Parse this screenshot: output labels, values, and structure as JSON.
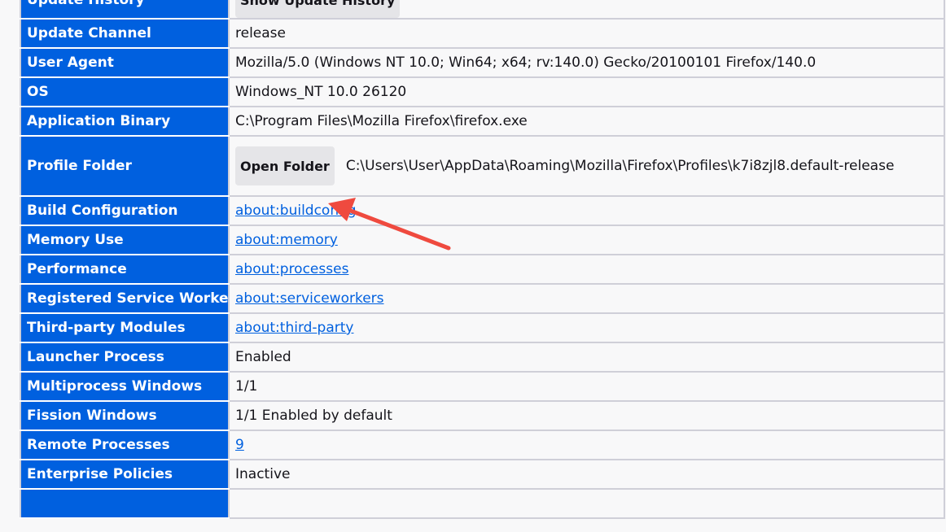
{
  "app_info": {
    "rows": [
      {
        "label": "Update History",
        "button": "Show Update History"
      },
      {
        "label": "Update Channel",
        "value": "release"
      },
      {
        "label": "User Agent",
        "value": "Mozilla/5.0 (Windows NT 10.0; Win64; x64; rv:140.0) Gecko/20100101 Firefox/140.0"
      },
      {
        "label": "OS",
        "value": "Windows_NT 10.0 26120"
      },
      {
        "label": "Application Binary",
        "value": "C:\\Program Files\\Mozilla Firefox\\firefox.exe"
      },
      {
        "label": "Profile Folder",
        "button": "Open Folder",
        "value": "C:\\Users\\User\\AppData\\Roaming\\Mozilla\\Firefox\\Profiles\\k7i8zjl8.default-release"
      },
      {
        "label": "Build Configuration",
        "link": "about:buildconfig"
      },
      {
        "label": "Memory Use",
        "link": "about:memory"
      },
      {
        "label": "Performance",
        "link": "about:processes"
      },
      {
        "label": "Registered Service Workers",
        "link": "about:serviceworkers"
      },
      {
        "label": "Third-party Modules",
        "link": "about:third-party"
      },
      {
        "label": "Launcher Process",
        "value": "Enabled"
      },
      {
        "label": "Multiprocess Windows",
        "value": "1/1"
      },
      {
        "label": "Fission Windows",
        "value": "1/1 Enabled by default"
      },
      {
        "label": "Remote Processes",
        "link": "9"
      },
      {
        "label": "Enterprise Policies",
        "value": "Inactive"
      }
    ]
  },
  "colors": {
    "header_bg": "#0060df",
    "link": "#0060df",
    "annotation_arrow": "#ef4a3f"
  }
}
